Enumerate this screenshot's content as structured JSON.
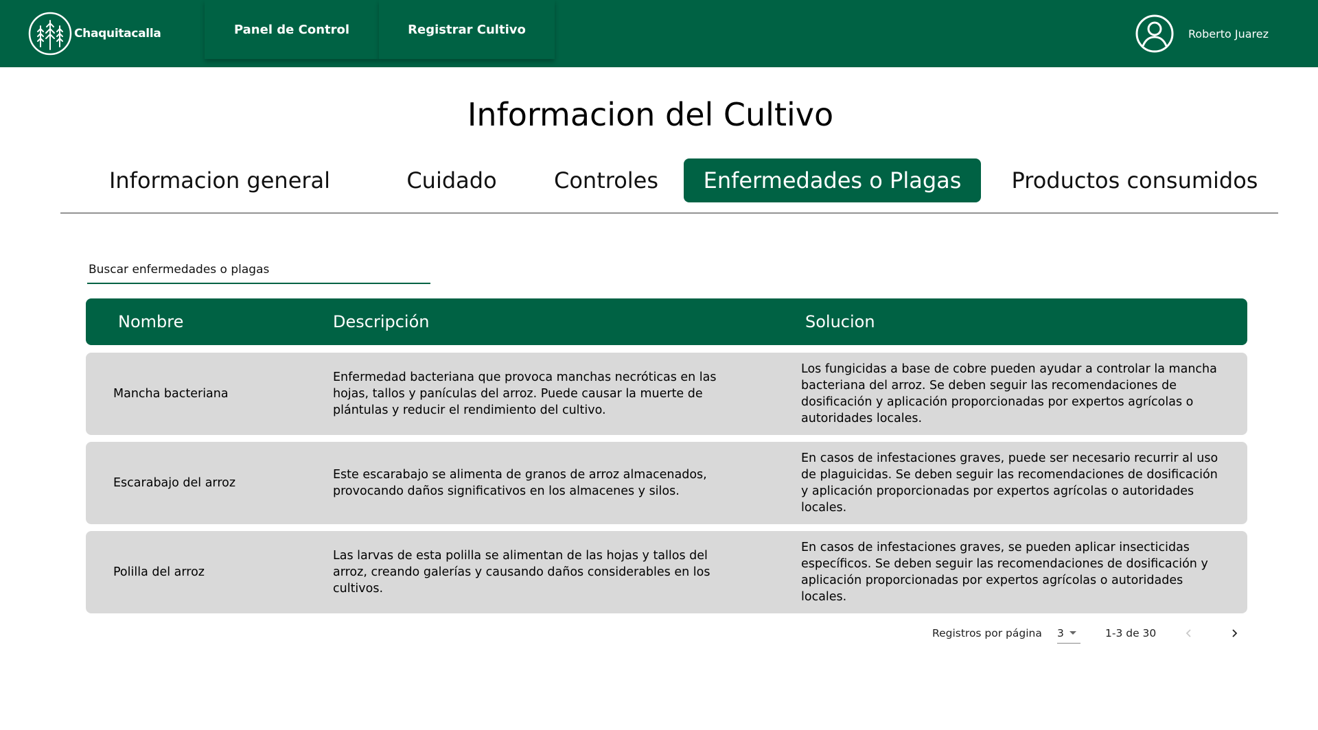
{
  "app": {
    "name": "Chaquitacalla"
  },
  "nav": {
    "items": [
      {
        "label": "Panel de Control"
      },
      {
        "label": "Registrar Cultivo"
      }
    ]
  },
  "user": {
    "name": "Roberto Juarez"
  },
  "page": {
    "title": "Informacion del Cultivo"
  },
  "tabs": [
    {
      "label": "Informacion general",
      "active": false
    },
    {
      "label": "Cuidado",
      "active": false
    },
    {
      "label": "Controles",
      "active": false
    },
    {
      "label": "Enfermedades o Plagas",
      "active": true
    },
    {
      "label": "Productos consumidos",
      "active": false
    }
  ],
  "search": {
    "placeholder": "Buscar enfermedades o plagas",
    "value": ""
  },
  "table": {
    "headers": [
      "Nombre",
      "Descripción",
      "Solucion"
    ],
    "rows": [
      {
        "nombre": "Mancha bacteriana",
        "descripcion": "Enfermedad bacteriana que provoca manchas necróticas en las hojas, tallos y panículas del arroz. Puede causar la muerte de plántulas y reducir el rendimiento del cultivo.",
        "solucion": "Los fungicidas a base de cobre pueden ayudar a controlar la mancha bacteriana del arroz. Se deben seguir las recomendaciones de dosificación y aplicación proporcionadas por expertos agrícolas o autoridades locales."
      },
      {
        "nombre": "Escarabajo del arroz",
        "descripcion": "Este escarabajo se alimenta de granos de arroz almacenados, provocando daños significativos en los almacenes y silos.",
        "solucion": "En casos de infestaciones graves, puede ser necesario recurrir al uso de plaguicidas. Se deben seguir las recomendaciones de dosificación y aplicación proporcionadas por expertos agrícolas o autoridades locales."
      },
      {
        "nombre": "Polilla del arroz",
        "descripcion": "Las larvas de esta polilla se alimentan de las hojas y tallos del arroz, creando galerías y causando daños considerables en los cultivos.",
        "solucion": "En casos de infestaciones graves, se pueden aplicar insecticidas específicos. Se deben seguir las recomendaciones de dosificación y aplicación proporcionadas por expertos agrícolas o autoridades locales."
      }
    ]
  },
  "pagination": {
    "rows_per_page_label": "Registros por página",
    "rows_per_page": "3",
    "range": "1-3 de 30"
  },
  "icons": {
    "logo": "wheat-logo-icon",
    "user": "user-avatar-icon",
    "prev": "chevron-left-icon",
    "next": "chevron-right-icon",
    "dropdown": "caret-down-icon"
  },
  "colors": {
    "brand": "#006244",
    "row_bg": "#d9d9d9",
    "text_on_brand": "#ffffff"
  }
}
